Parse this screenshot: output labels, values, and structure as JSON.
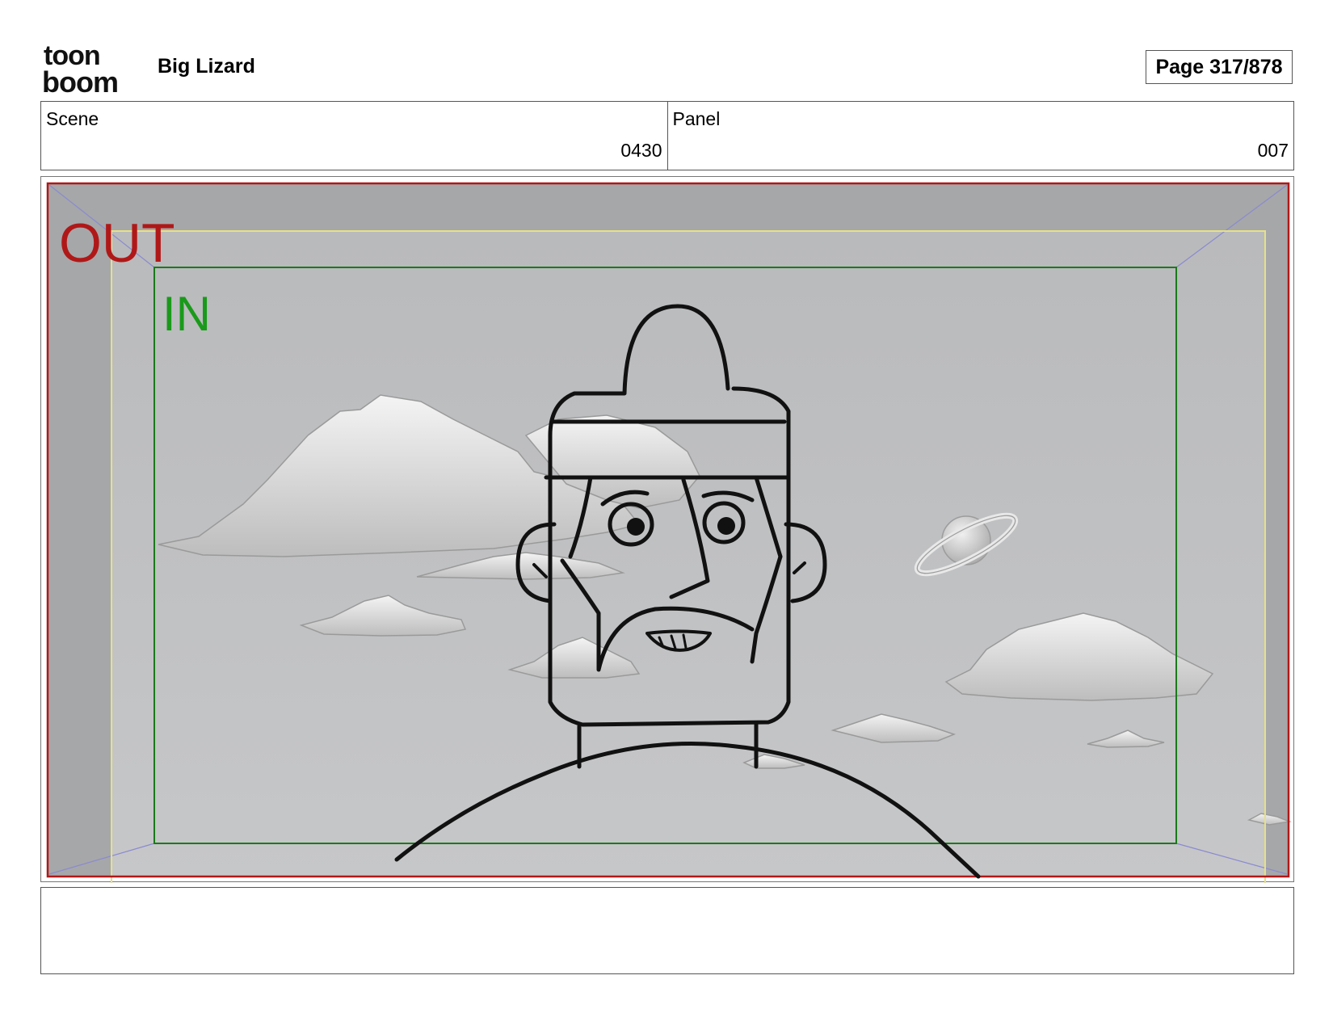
{
  "header": {
    "logo_text_top": "toon",
    "logo_text_bottom": "boom",
    "project_title": "Big Lizard",
    "page_label": "Page 317/878"
  },
  "info": {
    "scene_label": "Scene",
    "scene_value": "0430",
    "panel_label": "Panel",
    "panel_value": "007"
  },
  "panel": {
    "out_label": "OUT",
    "in_label": "IN",
    "colors": {
      "out_frame": "#b01818",
      "in_frame": "#1a7a1a",
      "title_safe": "#e6e08a",
      "camera_guides": "#8a8ad0",
      "background": "#c3c4c6"
    }
  },
  "dialogue": {
    "text": ""
  }
}
